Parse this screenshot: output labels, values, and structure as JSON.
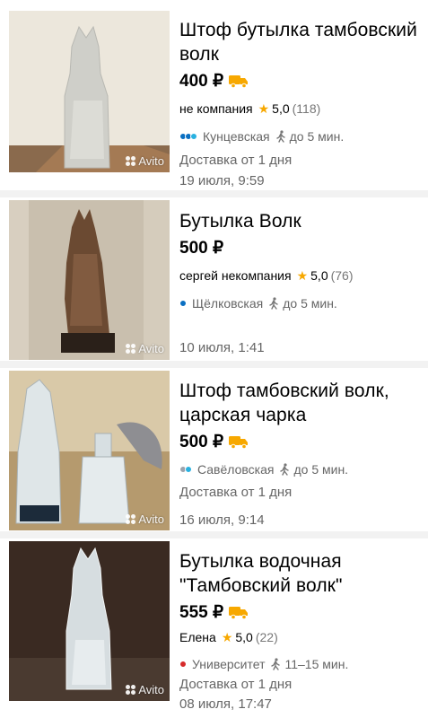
{
  "listings": [
    {
      "title": "Штоф бутылка тамбовский волк",
      "price": "400 ₽",
      "has_delivery_badge": true,
      "seller": "не компания",
      "rating": "5,0",
      "reviews": "(118)",
      "metro": "Кунцевская",
      "metro_colors": [
        "#0a6fc2",
        "#0a6fc2",
        "#29b1e0"
      ],
      "walk_time": "до 5 мин.",
      "delivery": "Доставка от 1 дня",
      "date": "19 июля, 9:59",
      "watermark": "Avito"
    },
    {
      "title": "Бутылка Волк",
      "price": "500 ₽",
      "has_delivery_badge": false,
      "seller": "сергей некомпания",
      "rating": "5,0",
      "reviews": "(76)",
      "metro": "Щёлковская",
      "metro_colors": [
        "#0a6fc2"
      ],
      "walk_time": "до 5 мин.",
      "delivery": "",
      "date": "10 июля, 1:41",
      "watermark": "Avito"
    },
    {
      "title": "Штоф тамбовский волк, царская чарка",
      "price": "500 ₽",
      "has_delivery_badge": true,
      "seller": "",
      "rating": "",
      "reviews": "",
      "metro": "Савёловская",
      "metro_colors": [
        "#9ca3ad",
        "#29b1e0"
      ],
      "walk_time": "до 5 мин.",
      "delivery": "Доставка от 1 дня",
      "date": "16 июля, 9:14",
      "watermark": "Avito"
    },
    {
      "title": "Бутылка водочная \"Тамбовский волк\"",
      "price": "555 ₽",
      "has_delivery_badge": true,
      "seller": "Елена",
      "rating": "5,0",
      "reviews": "(22)",
      "metro": "Университет",
      "metro_colors": [
        "#d62b2b"
      ],
      "walk_time": "11–15 мин.",
      "delivery": "Доставка от 1 дня",
      "date": "08 июля, 17:47",
      "watermark": "Avito"
    }
  ],
  "colors": {
    "star": "#f7a800",
    "delivery_badge": "#f7a800",
    "muted_text": "#666666"
  },
  "icons": {
    "star": "star-icon",
    "truck": "delivery-truck-icon",
    "walk": "walking-person-icon",
    "metro": "metro-line-dot-icon"
  }
}
